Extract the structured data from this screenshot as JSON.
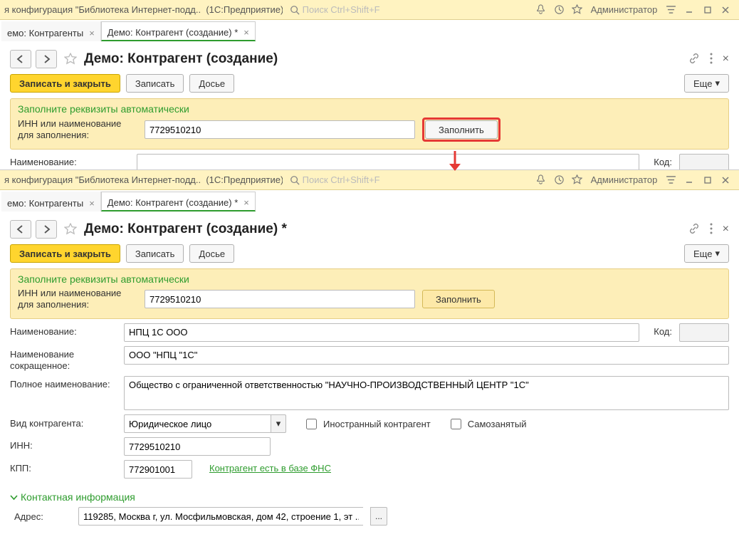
{
  "titlebar": {
    "config_partial": "я конфигурация \"Библиотека Интернет-подд...",
    "app": "(1С:Предприятие)",
    "search_placeholder": "Поиск Ctrl+Shift+F",
    "user": "Администратор"
  },
  "tabs": {
    "list": "емо: Контрагенты",
    "form": "Демо: Контрагент (создание) *"
  },
  "screen1": {
    "title": "Демо: Контрагент (создание)",
    "btn_save_close": "Записать и закрыть",
    "btn_save": "Записать",
    "btn_dossier": "Досье",
    "btn_more": "Еще",
    "fill_section": "Заполните реквизиты автоматически",
    "fill_label": "ИНН или наименование для заполнения:",
    "fill_value": "7729510210",
    "btn_fill": "Заполнить",
    "name_label": "Наименование:",
    "name_value": "",
    "code_label": "Код:"
  },
  "screen2": {
    "title": "Демо: Контрагент (создание) *",
    "btn_save_close": "Записать и закрыть",
    "btn_save": "Записать",
    "btn_dossier": "Досье",
    "btn_more": "Еще",
    "fill_section": "Заполните реквизиты автоматически",
    "fill_label": "ИНН или наименование для заполнения:",
    "fill_value": "7729510210",
    "btn_fill": "Заполнить",
    "name_label": "Наименование:",
    "name_value": "НПЦ 1С ООО",
    "code_label": "Код:",
    "short_label": "Наименование сокращенное:",
    "short_value": "ООО \"НПЦ \"1С\"",
    "full_label": "Полное наименование:",
    "full_value": "Общество с ограниченной ответственностью \"НАУЧНО-ПРОИЗВОДСТВЕННЫЙ ЦЕНТР \"1С\"",
    "kind_label": "Вид контрагента:",
    "kind_value": "Юридическое лицо",
    "chk_foreign": "Иностранный контрагент",
    "chk_self": "Самозанятый",
    "inn_label": "ИНН:",
    "inn_value": "7729510210",
    "kpp_label": "КПП:",
    "kpp_value": "772901001",
    "fns_link": "Контрагент есть в базе ФНС",
    "contact_section": "Контактная информация",
    "addr_label": "Адрес:",
    "addr_value": "119285, Москва г, ул. Мосфильмовская, дом 42, строение 1, эт ..."
  }
}
